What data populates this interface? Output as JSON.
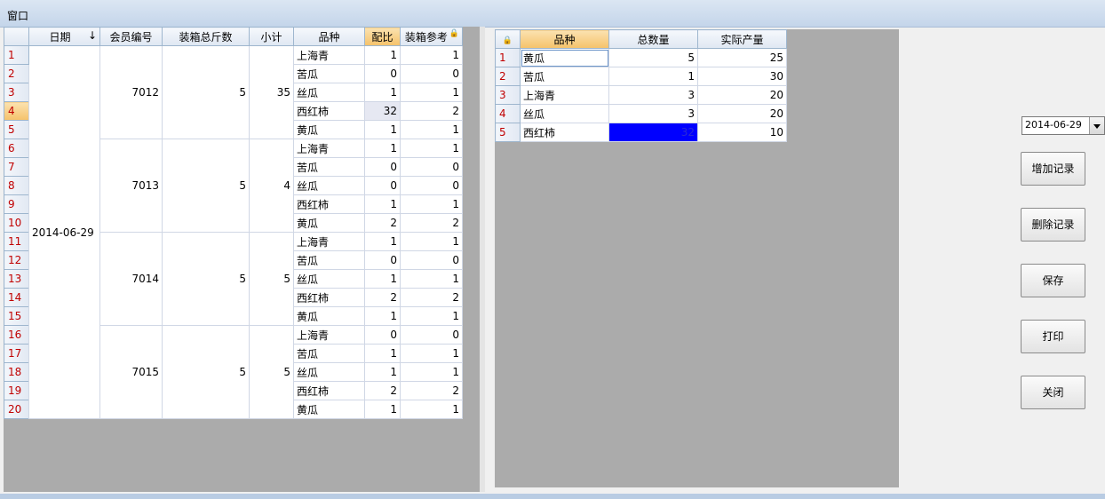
{
  "window": {
    "title": "窗口"
  },
  "left_grid": {
    "headers": [
      "日期",
      "会员编号",
      "装箱总斤数",
      "小计",
      "品种",
      "配比",
      "装箱参考"
    ],
    "date": "2014-06-29",
    "row_numbers": [
      "1",
      "2",
      "3",
      "4",
      "5",
      "6",
      "7",
      "8",
      "9",
      "10",
      "11",
      "12",
      "13",
      "14",
      "15",
      "16",
      "17",
      "18",
      "19",
      "20"
    ],
    "groups": [
      {
        "member": "7012",
        "total": "5",
        "subtotal": "35",
        "rows": [
          {
            "variety": "上海青",
            "ratio": "1",
            "ref": "1"
          },
          {
            "variety": "苦瓜",
            "ratio": "0",
            "ref": "0"
          },
          {
            "variety": "丝瓜",
            "ratio": "1",
            "ref": "1"
          },
          {
            "variety": "西红柿",
            "ratio": "32",
            "ref": "2"
          },
          {
            "variety": "黄瓜",
            "ratio": "1",
            "ref": "1"
          }
        ]
      },
      {
        "member": "7013",
        "total": "5",
        "subtotal": "4",
        "rows": [
          {
            "variety": "上海青",
            "ratio": "1",
            "ref": "1"
          },
          {
            "variety": "苦瓜",
            "ratio": "0",
            "ref": "0"
          },
          {
            "variety": "丝瓜",
            "ratio": "0",
            "ref": "0"
          },
          {
            "variety": "西红柿",
            "ratio": "1",
            "ref": "1"
          },
          {
            "variety": "黄瓜",
            "ratio": "2",
            "ref": "2"
          }
        ]
      },
      {
        "member": "7014",
        "total": "5",
        "subtotal": "5",
        "rows": [
          {
            "variety": "上海青",
            "ratio": "1",
            "ref": "1"
          },
          {
            "variety": "苦瓜",
            "ratio": "0",
            "ref": "0"
          },
          {
            "variety": "丝瓜",
            "ratio": "1",
            "ref": "1"
          },
          {
            "variety": "西红柿",
            "ratio": "2",
            "ref": "2"
          },
          {
            "variety": "黄瓜",
            "ratio": "1",
            "ref": "1"
          }
        ]
      },
      {
        "member": "7015",
        "total": "5",
        "subtotal": "5",
        "rows": [
          {
            "variety": "上海青",
            "ratio": "0",
            "ref": "0"
          },
          {
            "variety": "苦瓜",
            "ratio": "1",
            "ref": "1"
          },
          {
            "variety": "丝瓜",
            "ratio": "1",
            "ref": "1"
          },
          {
            "variety": "西红柿",
            "ratio": "2",
            "ref": "2"
          },
          {
            "variety": "黄瓜",
            "ratio": "1",
            "ref": "1"
          }
        ]
      }
    ]
  },
  "right_grid": {
    "headers": [
      "品种",
      "总数量",
      "实际产量"
    ],
    "rows": [
      {
        "num": "1",
        "variety": "黄瓜",
        "qty": "5",
        "output": "25"
      },
      {
        "num": "2",
        "variety": "苦瓜",
        "qty": "1",
        "output": "30"
      },
      {
        "num": "3",
        "variety": "上海青",
        "qty": "3",
        "output": "20"
      },
      {
        "num": "4",
        "variety": "丝瓜",
        "qty": "3",
        "output": "20"
      },
      {
        "num": "5",
        "variety": "西红柿",
        "qty": "32",
        "output": "10"
      }
    ]
  },
  "controls": {
    "date_value": "2014-06-29",
    "add_label": "增加记录",
    "delete_label": "删除记录",
    "save_label": "保存",
    "print_label": "打印",
    "close_label": "关闭"
  }
}
